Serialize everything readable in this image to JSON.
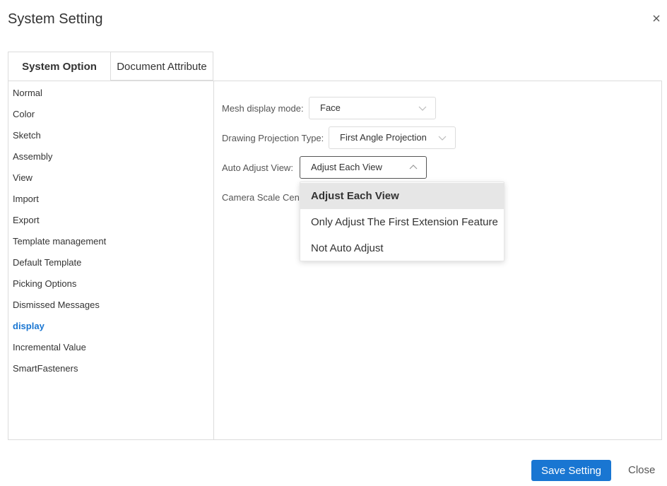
{
  "dialog": {
    "title": "System Setting"
  },
  "tabs": [
    {
      "label": "System Option",
      "active": true
    },
    {
      "label": "Document Attribute",
      "active": false
    }
  ],
  "sidebar": {
    "items": [
      {
        "label": "Normal"
      },
      {
        "label": "Color"
      },
      {
        "label": "Sketch"
      },
      {
        "label": "Assembly"
      },
      {
        "label": "View"
      },
      {
        "label": "Import"
      },
      {
        "label": "Export"
      },
      {
        "label": "Template management"
      },
      {
        "label": "Default Template"
      },
      {
        "label": "Picking Options"
      },
      {
        "label": "Dismissed Messages"
      },
      {
        "label": "display",
        "active": true
      },
      {
        "label": "Incremental Value"
      },
      {
        "label": "SmartFasteners"
      }
    ]
  },
  "settings": {
    "mesh_display": {
      "label": "Mesh display mode:",
      "value": "Face"
    },
    "drawing_projection": {
      "label": "Drawing Projection Type:",
      "value": "First Angle Projection"
    },
    "auto_adjust": {
      "label": "Auto Adjust View:",
      "value": "Adjust Each View",
      "options": [
        "Adjust Each View",
        "Only Adjust The First Extension Feature",
        "Not Auto Adjust"
      ]
    },
    "camera_scale": {
      "label": "Camera Scale Cente"
    }
  },
  "footer": {
    "save_label": "Save Setting",
    "close_label": "Close"
  },
  "colors": {
    "accent": "#1976d2",
    "border": "#dcdcdc",
    "hover_bg": "#e6e6e6"
  }
}
